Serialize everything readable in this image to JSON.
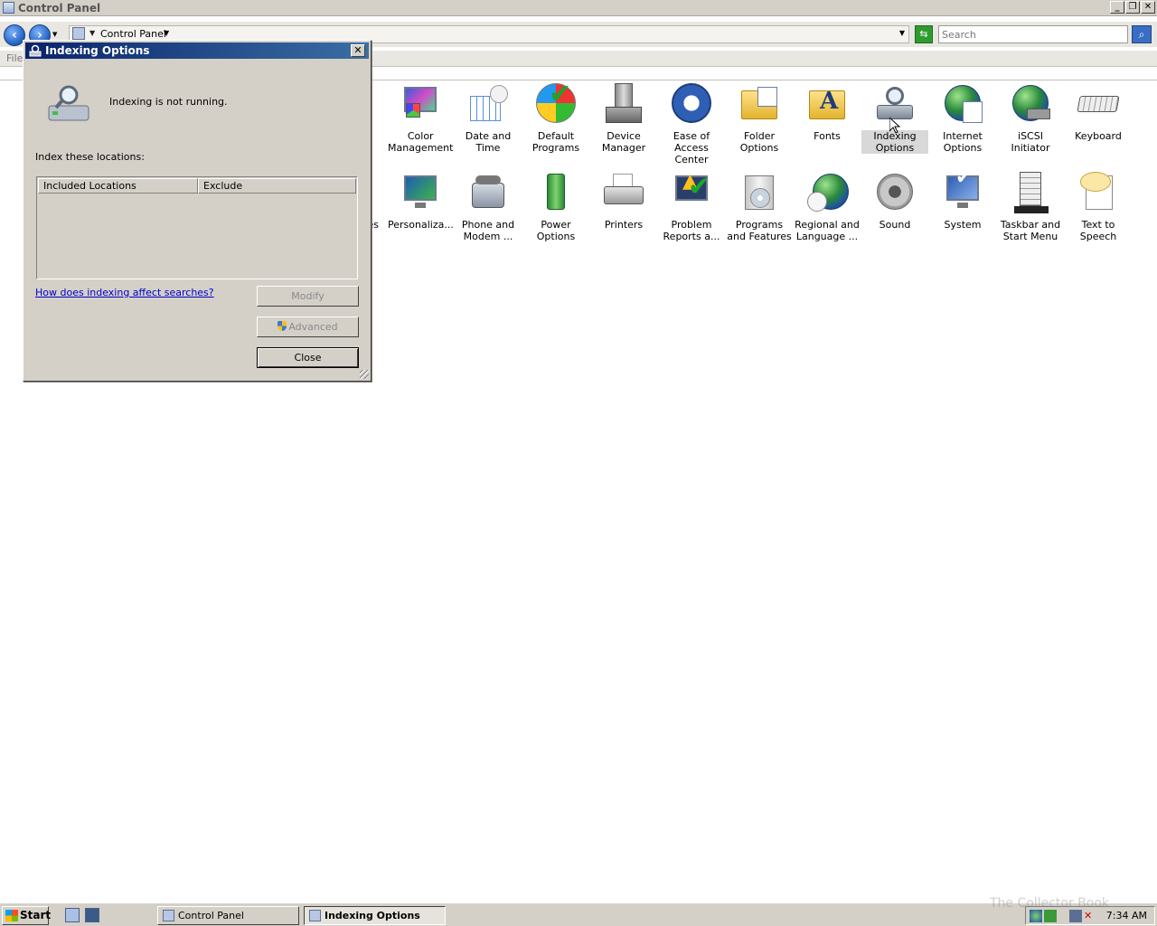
{
  "window": {
    "title": "Control Panel"
  },
  "navbar": {
    "back": "‹",
    "forward": "›",
    "breadcrumb": "Control Panel",
    "search_placeholder": "Search"
  },
  "menubar": {
    "file": "File"
  },
  "control_panel_items": [
    {
      "label": "Color Management",
      "icon": "color-management-icon"
    },
    {
      "label": "Date and Time",
      "icon": "date-time-icon"
    },
    {
      "label": "Default Programs",
      "icon": "default-programs-icon"
    },
    {
      "label": "Device Manager",
      "icon": "device-manager-icon"
    },
    {
      "label": "Ease of Access Center",
      "icon": "ease-of-access-icon"
    },
    {
      "label": "Folder Options",
      "icon": "folder-options-icon"
    },
    {
      "label": "Fonts",
      "icon": "fonts-icon"
    },
    {
      "label": "Indexing Options",
      "icon": "indexing-options-icon",
      "selected": true
    },
    {
      "label": "Internet Options",
      "icon": "internet-options-icon"
    },
    {
      "label": "iSCSI Initiator",
      "icon": "iscsi-initiator-icon"
    },
    {
      "label": "Keyboard",
      "icon": "keyboard-icon"
    },
    {
      "label": "es",
      "icon": "partial-item-icon"
    },
    {
      "label": "Personaliza...",
      "icon": "personalization-icon"
    },
    {
      "label": "Phone and Modem ...",
      "icon": "phone-modem-icon"
    },
    {
      "label": "Power Options",
      "icon": "power-options-icon"
    },
    {
      "label": "Printers",
      "icon": "printers-icon"
    },
    {
      "label": "Problem Reports a...",
      "icon": "problem-reports-icon"
    },
    {
      "label": "Programs and Features",
      "icon": "programs-features-icon"
    },
    {
      "label": "Regional and Language ...",
      "icon": "regional-language-icon"
    },
    {
      "label": "Sound",
      "icon": "sound-icon"
    },
    {
      "label": "System",
      "icon": "system-icon"
    },
    {
      "label": "Taskbar and Start Menu",
      "icon": "taskbar-start-menu-icon"
    },
    {
      "label": "Text to Speech",
      "icon": "text-to-speech-icon"
    }
  ],
  "dialog": {
    "title": "Indexing Options",
    "status": "Indexing is not running.",
    "locations_label": "Index these locations:",
    "columns": [
      "Included Locations",
      "Exclude"
    ],
    "help_link": "How does indexing affect searches?",
    "modify_label": "Modify",
    "advanced_label": "Advanced",
    "close_label": "Close"
  },
  "taskbar": {
    "start_label": "Start",
    "tasks": [
      {
        "label": "Control Panel",
        "active": false
      },
      {
        "label": "Indexing Options",
        "active": true
      }
    ],
    "clock": "7:34 AM"
  },
  "watermark": "The Collector Book"
}
